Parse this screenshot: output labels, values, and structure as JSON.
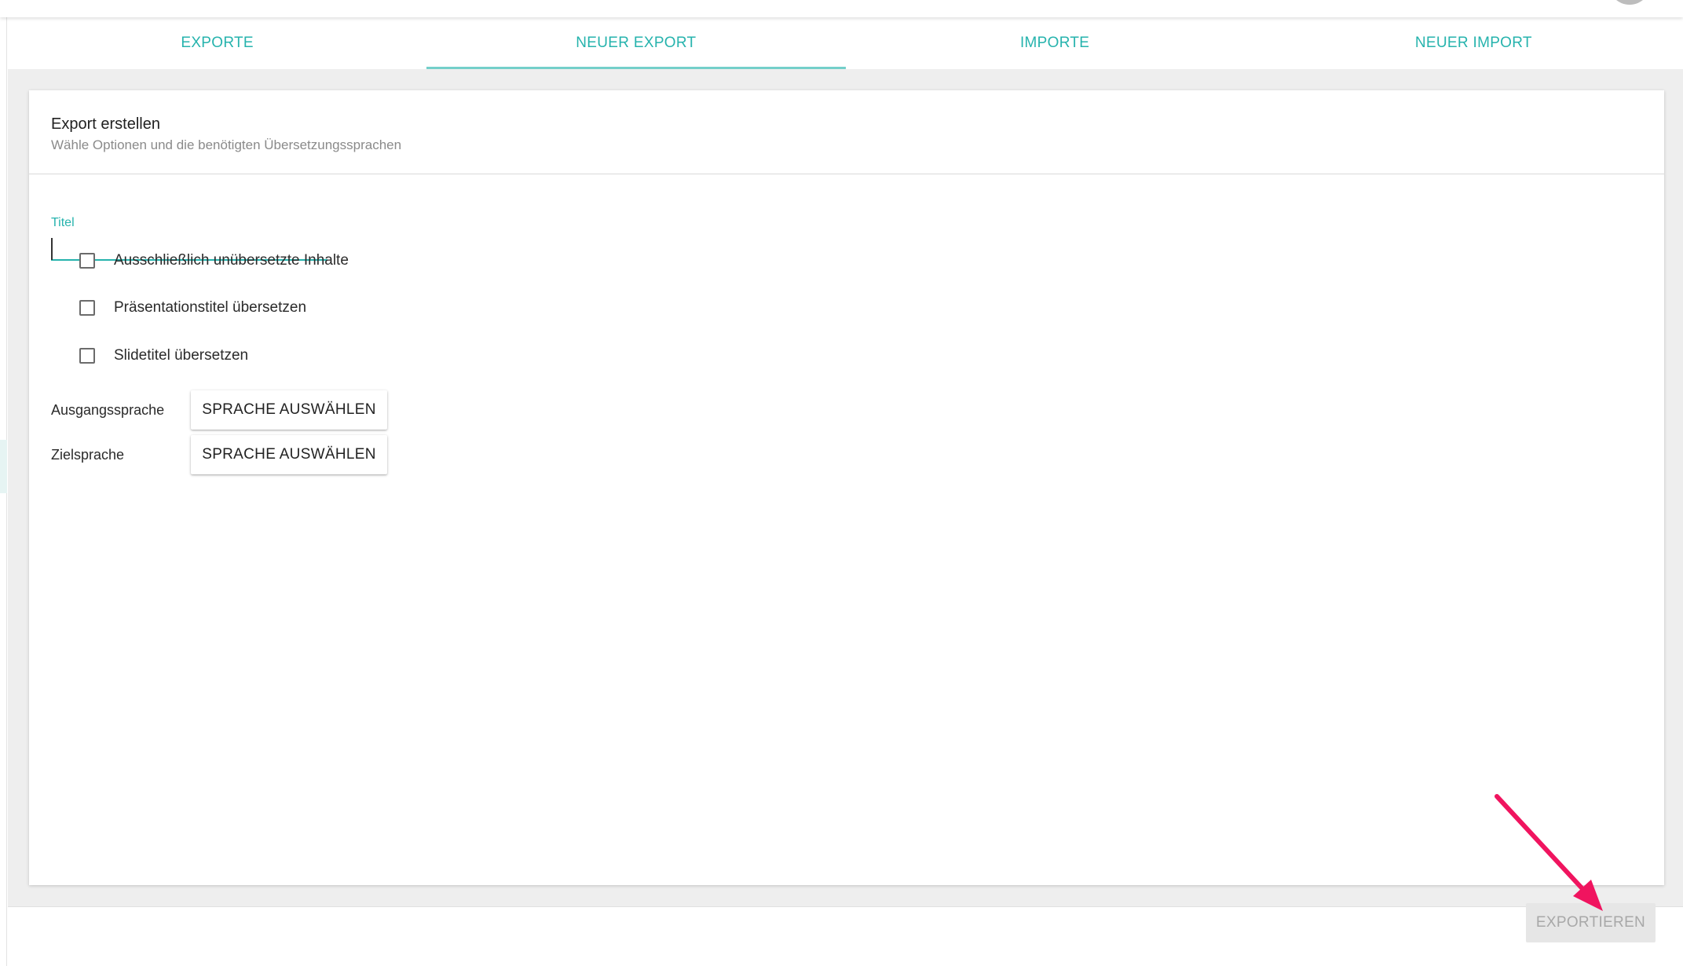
{
  "tabs": [
    {
      "label": "EXPORTE",
      "active": false
    },
    {
      "label": "NEUER EXPORT",
      "active": true
    },
    {
      "label": "IMPORTE",
      "active": false
    },
    {
      "label": "NEUER IMPORT",
      "active": false
    }
  ],
  "card": {
    "title": "Export erstellen",
    "subtitle": "Wähle Optionen und die benötigten Übersetzungssprachen"
  },
  "form": {
    "title_label": "Titel",
    "title_value": "",
    "checkboxes": [
      {
        "label": "Ausschließlich unübersetzte Inhalte",
        "checked": false
      },
      {
        "label": "Präsentationstitel übersetzen",
        "checked": false
      },
      {
        "label": "Slidetitel übersetzen",
        "checked": false
      }
    ],
    "source_language": {
      "label": "Ausgangssprache",
      "button": "SPRACHE AUSWÄHLEN"
    },
    "target_language": {
      "label": "Zielsprache",
      "button": "SPRACHE AUSWÄHLEN"
    }
  },
  "footer": {
    "export_button": "EXPORTIEREN",
    "export_enabled": false
  },
  "colors": {
    "accent": "#26b3ad",
    "tab_indicator": "#74cfca",
    "annotation_arrow": "#f0145f",
    "disabled_button_bg": "#e6e6e6",
    "disabled_button_text": "#a8a8a8"
  },
  "icons": {
    "annotation": "arrow-pointer-icon",
    "checkbox": "checkbox-unchecked-icon",
    "avatar": "user-avatar"
  }
}
